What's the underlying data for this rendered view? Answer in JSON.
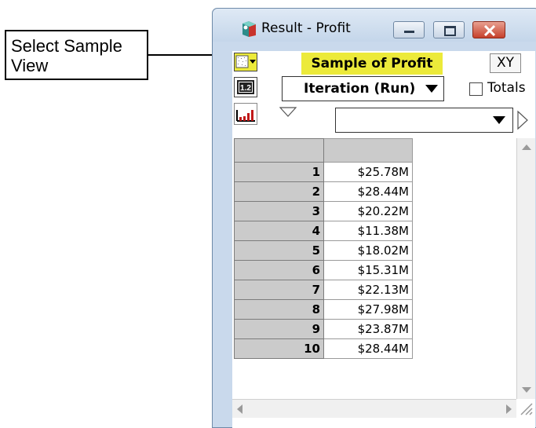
{
  "callout": {
    "line1": "Select Sample",
    "line2": "View"
  },
  "window": {
    "title": "Result - Profit",
    "view_label": "Sample of Profit",
    "xy_label": "XY",
    "iteration_select": "Iteration (Run)",
    "totals_label": "Totals",
    "index_select": ""
  },
  "grid": {
    "rows": [
      {
        "index": "1",
        "value": "$25.78M"
      },
      {
        "index": "2",
        "value": "$28.44M"
      },
      {
        "index": "3",
        "value": "$20.22M"
      },
      {
        "index": "4",
        "value": "$11.38M"
      },
      {
        "index": "5",
        "value": "$18.02M"
      },
      {
        "index": "6",
        "value": "$15.31M"
      },
      {
        "index": "7",
        "value": "$22.13M"
      },
      {
        "index": "8",
        "value": "$27.98M"
      },
      {
        "index": "9",
        "value": "$23.87M"
      },
      {
        "index": "10",
        "value": "$28.44M"
      }
    ]
  },
  "colors": {
    "highlight": "#ecea3a",
    "title_bar": "#c9d9ec",
    "header_cell": "#cbcbcb"
  },
  "icons": [
    "app-icon",
    "view-sample-icon",
    "number-format-icon",
    "graph-icon",
    "close-icon",
    "minimize-icon",
    "maximize-icon"
  ]
}
